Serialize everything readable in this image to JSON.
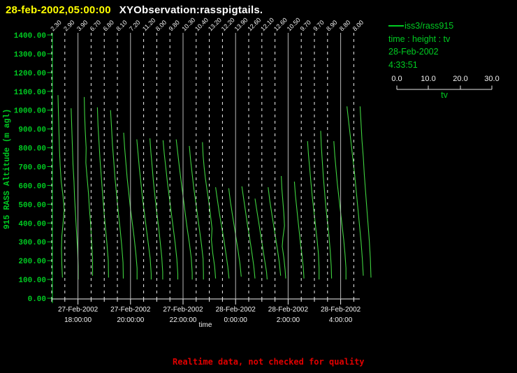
{
  "titlebar": {
    "timestamp": "28-feb-2002,05:00:00",
    "app_title": "XYObservation:rasspigtails."
  },
  "legend": {
    "series": "iss3/rass915",
    "fields": "time : height : tv",
    "date": "28-Feb-2002",
    "time": "4:33:51",
    "scale": {
      "ticks": [
        "0.0",
        "10.0",
        "20.0",
        "30.0"
      ],
      "label": "tv",
      "min": 0,
      "max": 30
    }
  },
  "footer": {
    "warning": "Realtime data, not checked for quality"
  },
  "colors": {
    "background": "#000000",
    "title_yellow": "#ffff00",
    "axis_green": "#00cc22",
    "trace_green": "#3fd23f",
    "white": "#f2f2f2",
    "major_gridline": "#b8b8b8",
    "warning_red": "#e00000"
  },
  "chart_data": {
    "type": "line",
    "title": "",
    "xlabel": "time",
    "ylabel": "915 RASS Altitude (m agl)",
    "ylim": [
      0,
      1400
    ],
    "y_tick_labels": [
      "0.00",
      "100.00",
      "200.00",
      "300.00",
      "400.00",
      "500.00",
      "600.00",
      "700.00",
      "800.00",
      "900.00",
      "1000.00",
      "1100.00",
      "1200.00",
      "1300.00",
      "1400.00"
    ],
    "x_major_ticks": [
      {
        "date": "27-Feb-2002",
        "time": "18:00:00"
      },
      {
        "date": "27-Feb-2002",
        "time": "20:00:00"
      },
      {
        "date": "27-Feb-2002",
        "time": "22:00:00"
      },
      {
        "date": "28-Feb-2002",
        "time": "0:00:00"
      },
      {
        "date": "28-Feb-2002",
        "time": "2:00:00"
      },
      {
        "date": "28-Feb-2002",
        "time": "4:00:00"
      }
    ],
    "profile_interval_minutes": 30,
    "tv_axis": {
      "min": 0,
      "max": 30,
      "units_per_div": 10
    },
    "grid": "vertical dashed line at each profile time; solid gray line at 2-hour marks",
    "legend_position": "right",
    "profiles": [
      {
        "time": "17:00",
        "label": "2.30",
        "points": [
          [
            2.3,
            1080
          ],
          [
            2.45,
            980
          ],
          [
            2.6,
            880
          ],
          [
            2.75,
            790
          ],
          [
            3.0,
            700
          ],
          [
            3.3,
            620
          ],
          [
            3.9,
            540
          ],
          [
            4.25,
            470
          ],
          [
            3.9,
            400
          ],
          [
            3.5,
            330
          ],
          [
            3.4,
            260
          ],
          [
            3.5,
            180
          ],
          [
            3.7,
            110
          ]
        ]
      },
      {
        "time": "17:30",
        "label": "2.90",
        "points": [
          [
            2.9,
            1010
          ],
          [
            3.1,
            910
          ],
          [
            3.3,
            810
          ],
          [
            3.5,
            710
          ],
          [
            3.8,
            620
          ],
          [
            4.0,
            530
          ],
          [
            4.3,
            440
          ],
          [
            4.6,
            350
          ],
          [
            4.9,
            260
          ],
          [
            5.1,
            170
          ],
          [
            5.1,
            100
          ]
        ]
      },
      {
        "time": "18:00",
        "label": "3.90",
        "points": [
          [
            3.9,
            1070
          ],
          [
            4.0,
            980
          ],
          [
            4.2,
            890
          ],
          [
            4.5,
            800
          ],
          [
            4.4,
            720
          ],
          [
            4.8,
            640
          ],
          [
            5.2,
            560
          ],
          [
            5.5,
            480
          ],
          [
            5.9,
            390
          ],
          [
            6.2,
            300
          ],
          [
            6.5,
            210
          ],
          [
            6.5,
            120
          ]
        ]
      },
      {
        "time": "18:30",
        "label": "6.70",
        "points": [
          [
            6.7,
            1015
          ],
          [
            6.9,
            920
          ],
          [
            7.2,
            830
          ],
          [
            7.5,
            740
          ],
          [
            7.9,
            650
          ],
          [
            8.3,
            560
          ],
          [
            8.7,
            470
          ],
          [
            9.2,
            380
          ],
          [
            9.7,
            290
          ],
          [
            10.1,
            200
          ],
          [
            10.2,
            110
          ]
        ]
      },
      {
        "time": "19:00",
        "label": "6.80",
        "points": [
          [
            6.8,
            1000
          ],
          [
            7.1,
            910
          ],
          [
            7.4,
            820
          ],
          [
            7.8,
            730
          ],
          [
            8.2,
            640
          ],
          [
            8.7,
            550
          ],
          [
            9.2,
            460
          ],
          [
            9.8,
            370
          ],
          [
            10.3,
            280
          ],
          [
            10.7,
            190
          ],
          [
            10.8,
            105
          ]
        ]
      },
      {
        "time": "19:30",
        "label": "8.10",
        "points": [
          [
            8.1,
            880
          ],
          [
            8.4,
            800
          ],
          [
            8.8,
            720
          ],
          [
            9.2,
            640
          ],
          [
            9.7,
            560
          ],
          [
            10.2,
            480
          ],
          [
            10.8,
            400
          ],
          [
            11.4,
            320
          ],
          [
            11.9,
            240
          ],
          [
            12.3,
            160
          ],
          [
            12.3,
            100
          ]
        ]
      },
      {
        "time": "20:00",
        "label": "7.20",
        "points": [
          [
            7.2,
            845
          ],
          [
            7.6,
            770
          ],
          [
            8.0,
            690
          ],
          [
            8.5,
            610
          ],
          [
            9.0,
            530
          ],
          [
            9.6,
            450
          ],
          [
            10.2,
            370
          ],
          [
            10.8,
            290
          ],
          [
            11.4,
            210
          ],
          [
            11.7,
            130
          ],
          [
            11.7,
            100
          ]
        ]
      },
      {
        "time": "20:30",
        "label": "11.20",
        "points": [
          [
            11.2,
            850
          ],
          [
            11.5,
            775
          ],
          [
            11.9,
            700
          ],
          [
            12.3,
            620
          ],
          [
            12.8,
            540
          ],
          [
            13.3,
            460
          ],
          [
            13.9,
            380
          ],
          [
            14.4,
            300
          ],
          [
            14.9,
            220
          ],
          [
            15.2,
            140
          ],
          [
            15.2,
            100
          ]
        ]
      },
      {
        "time": "21:00",
        "label": "8.00",
        "points": [
          [
            8.0,
            840
          ],
          [
            8.4,
            765
          ],
          [
            8.9,
            690
          ],
          [
            9.4,
            610
          ],
          [
            10.0,
            530
          ],
          [
            10.6,
            450
          ],
          [
            11.2,
            370
          ],
          [
            11.8,
            290
          ],
          [
            12.3,
            210
          ],
          [
            12.6,
            130
          ],
          [
            12.6,
            100
          ]
        ]
      },
      {
        "time": "21:30",
        "label": "9.80",
        "points": [
          [
            9.8,
            845
          ],
          [
            10.3,
            770
          ],
          [
            10.8,
            695
          ],
          [
            11.4,
            615
          ],
          [
            12.0,
            535
          ],
          [
            12.6,
            455
          ],
          [
            13.2,
            375
          ],
          [
            13.9,
            295
          ],
          [
            14.5,
            215
          ],
          [
            14.8,
            135
          ],
          [
            14.8,
            100
          ]
        ]
      },
      {
        "time": "22:00",
        "label": "10.30",
        "points": [
          [
            10.3,
            810
          ],
          [
            10.7,
            735
          ],
          [
            11.2,
            660
          ],
          [
            11.7,
            585
          ],
          [
            12.3,
            510
          ],
          [
            12.9,
            435
          ],
          [
            13.5,
            360
          ],
          [
            14.1,
            285
          ],
          [
            14.6,
            210
          ],
          [
            14.7,
            130
          ],
          [
            14.7,
            100
          ]
        ]
      },
      {
        "time": "22:30",
        "label": "10.40",
        "points": [
          [
            10.4,
            830
          ],
          [
            10.6,
            760
          ],
          [
            10.9,
            700
          ],
          [
            11.3,
            640
          ],
          [
            11.8,
            580
          ],
          [
            12.4,
            510
          ],
          [
            12.9,
            440
          ],
          [
            13.4,
            370
          ],
          [
            13.2,
            310
          ],
          [
            13.6,
            240
          ],
          [
            14.2,
            170
          ],
          [
            14.5,
            105
          ]
        ]
      },
      {
        "time": "23:00",
        "label": "13.20",
        "points": [
          [
            13.2,
            590
          ],
          [
            13.8,
            520
          ],
          [
            14.4,
            450
          ],
          [
            15.1,
            380
          ],
          [
            15.8,
            310
          ],
          [
            16.4,
            240
          ],
          [
            17.0,
            170
          ],
          [
            17.4,
            105
          ]
        ]
      },
      {
        "time": "23:30",
        "label": "12.20",
        "points": [
          [
            12.2,
            585
          ],
          [
            12.7,
            515
          ],
          [
            13.3,
            450
          ],
          [
            13.9,
            385
          ],
          [
            14.5,
            320
          ],
          [
            15.1,
            255
          ],
          [
            15.7,
            185
          ],
          [
            16.1,
            115
          ]
        ]
      },
      {
        "time": "0:00",
        "label": "13.90",
        "points": [
          [
            13.9,
            595
          ],
          [
            14.5,
            525
          ],
          [
            15.1,
            455
          ],
          [
            15.7,
            385
          ],
          [
            16.4,
            315
          ],
          [
            17.0,
            245
          ],
          [
            17.6,
            175
          ],
          [
            18.0,
            105
          ]
        ]
      },
      {
        "time": "0:30",
        "label": "12.60",
        "points": [
          [
            12.6,
            530
          ],
          [
            13.2,
            465
          ],
          [
            13.8,
            400
          ],
          [
            14.4,
            335
          ],
          [
            15.0,
            270
          ],
          [
            15.6,
            205
          ],
          [
            16.2,
            140
          ],
          [
            16.4,
            100
          ]
        ]
      },
      {
        "time": "1:00",
        "label": "12.10",
        "points": [
          [
            12.1,
            590
          ],
          [
            12.6,
            520
          ],
          [
            13.2,
            455
          ],
          [
            13.8,
            390
          ],
          [
            14.4,
            325
          ],
          [
            15.0,
            260
          ],
          [
            15.6,
            190
          ],
          [
            16.0,
            120
          ]
        ]
      },
      {
        "time": "1:30",
        "label": "12.60",
        "points": [
          [
            12.6,
            650
          ],
          [
            12.8,
            580
          ],
          [
            13.1,
            515
          ],
          [
            13.4,
            450
          ],
          [
            13.6,
            385
          ],
          [
            13.1,
            320
          ],
          [
            12.9,
            275
          ],
          [
            13.4,
            215
          ],
          [
            13.8,
            150
          ],
          [
            14.0,
            105
          ]
        ]
      },
      {
        "time": "2:00",
        "label": "10.50",
        "points": [
          [
            10.5,
            620
          ],
          [
            10.8,
            550
          ],
          [
            11.2,
            485
          ],
          [
            11.6,
            420
          ],
          [
            12.0,
            355
          ],
          [
            12.4,
            290
          ],
          [
            12.9,
            225
          ],
          [
            13.3,
            160
          ],
          [
            13.5,
            105
          ]
        ]
      },
      {
        "time": "2:30",
        "label": "9.70",
        "points": [
          [
            9.7,
            835
          ],
          [
            10.0,
            760
          ],
          [
            10.4,
            685
          ],
          [
            10.8,
            610
          ],
          [
            11.2,
            535
          ],
          [
            11.7,
            460
          ],
          [
            12.2,
            385
          ],
          [
            12.7,
            310
          ],
          [
            13.1,
            235
          ],
          [
            13.3,
            160
          ],
          [
            13.3,
            100
          ]
        ]
      },
      {
        "time": "3:00",
        "label": "9.70",
        "points": [
          [
            9.7,
            890
          ],
          [
            9.9,
            810
          ],
          [
            10.2,
            730
          ],
          [
            10.5,
            650
          ],
          [
            10.9,
            570
          ],
          [
            11.3,
            490
          ],
          [
            11.8,
            410
          ],
          [
            12.3,
            330
          ],
          [
            12.7,
            250
          ],
          [
            13.0,
            170
          ],
          [
            13.1,
            105
          ]
        ]
      },
      {
        "time": "3:30",
        "label": "8.90",
        "points": [
          [
            8.9,
            835
          ],
          [
            9.2,
            760
          ],
          [
            9.6,
            685
          ],
          [
            10.0,
            610
          ],
          [
            10.5,
            535
          ],
          [
            11.0,
            460
          ],
          [
            11.5,
            385
          ],
          [
            12.0,
            310
          ],
          [
            12.4,
            235
          ],
          [
            12.7,
            160
          ],
          [
            12.7,
            100
          ]
        ]
      },
      {
        "time": "4:00",
        "label": "8.80",
        "points": [
          [
            8.8,
            1020
          ],
          [
            9.4,
            930
          ],
          [
            10.0,
            840
          ],
          [
            10.6,
            750
          ],
          [
            11.2,
            660
          ],
          [
            11.7,
            570
          ],
          [
            12.2,
            480
          ],
          [
            12.7,
            390
          ],
          [
            13.2,
            300
          ],
          [
            13.6,
            210
          ],
          [
            13.9,
            120
          ]
        ]
      },
      {
        "time": "4:30",
        "label": "8.00",
        "points": [
          [
            8.0,
            1020
          ],
          [
            8.3,
            930
          ],
          [
            8.6,
            840
          ],
          [
            9.0,
            750
          ],
          [
            9.3,
            660
          ],
          [
            9.7,
            570
          ],
          [
            10.1,
            480
          ],
          [
            10.5,
            390
          ],
          [
            10.9,
            300
          ],
          [
            11.2,
            210
          ],
          [
            11.4,
            110
          ]
        ]
      }
    ]
  }
}
